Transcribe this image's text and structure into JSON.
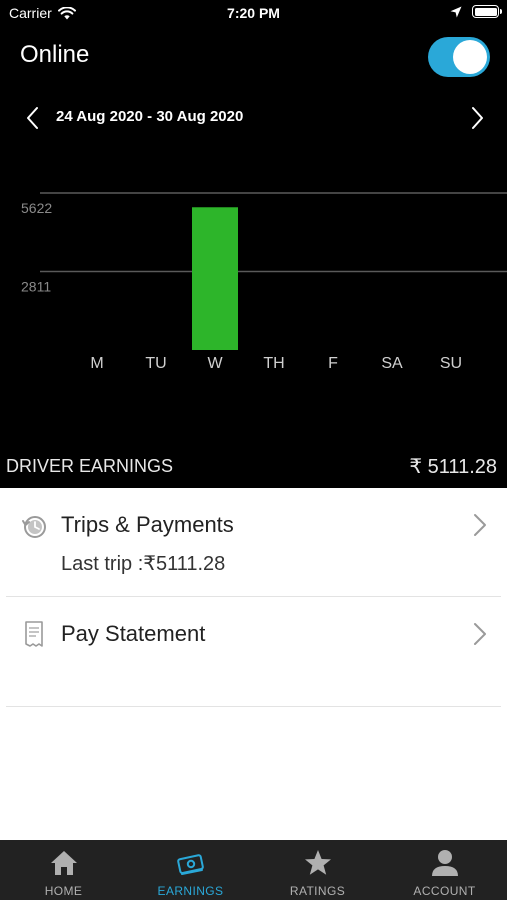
{
  "status_bar": {
    "carrier": "Carrier",
    "time": "7:20 PM"
  },
  "header": {
    "title": "Online",
    "toggle_on": true,
    "toggle_color": "#2aa8d8"
  },
  "week_nav": {
    "range": "24 Aug 2020 - 30 Aug 2020"
  },
  "chart_data": {
    "type": "bar",
    "categories": [
      "M",
      "TU",
      "W",
      "TH",
      "F",
      "SA",
      "SU"
    ],
    "values": [
      0,
      0,
      5111.28,
      0,
      0,
      0,
      0
    ],
    "y_ticks": [
      2811,
      5622
    ],
    "ylim": [
      0,
      5622
    ],
    "grid": true,
    "bar_color": "#2db52a"
  },
  "earnings": {
    "label": "DRIVER EARNINGS",
    "value": "₹ 5111.28"
  },
  "rows": [
    {
      "title": "Trips & Payments",
      "subtitle": "Last trip :₹5111.28",
      "icon": "history-clock-icon"
    },
    {
      "title": "Pay Statement",
      "icon": "receipt-icon"
    }
  ],
  "tabs": [
    {
      "label": "HOME",
      "icon": "home-icon",
      "active": false
    },
    {
      "label": "EARNINGS",
      "icon": "money-icon",
      "active": true
    },
    {
      "label": "RATINGS",
      "icon": "star-icon",
      "active": false
    },
    {
      "label": "ACCOUNT",
      "icon": "user-icon",
      "active": false
    }
  ],
  "colors": {
    "accent": "#2aa8d8",
    "bar": "#2db52a",
    "background": "#000000"
  }
}
